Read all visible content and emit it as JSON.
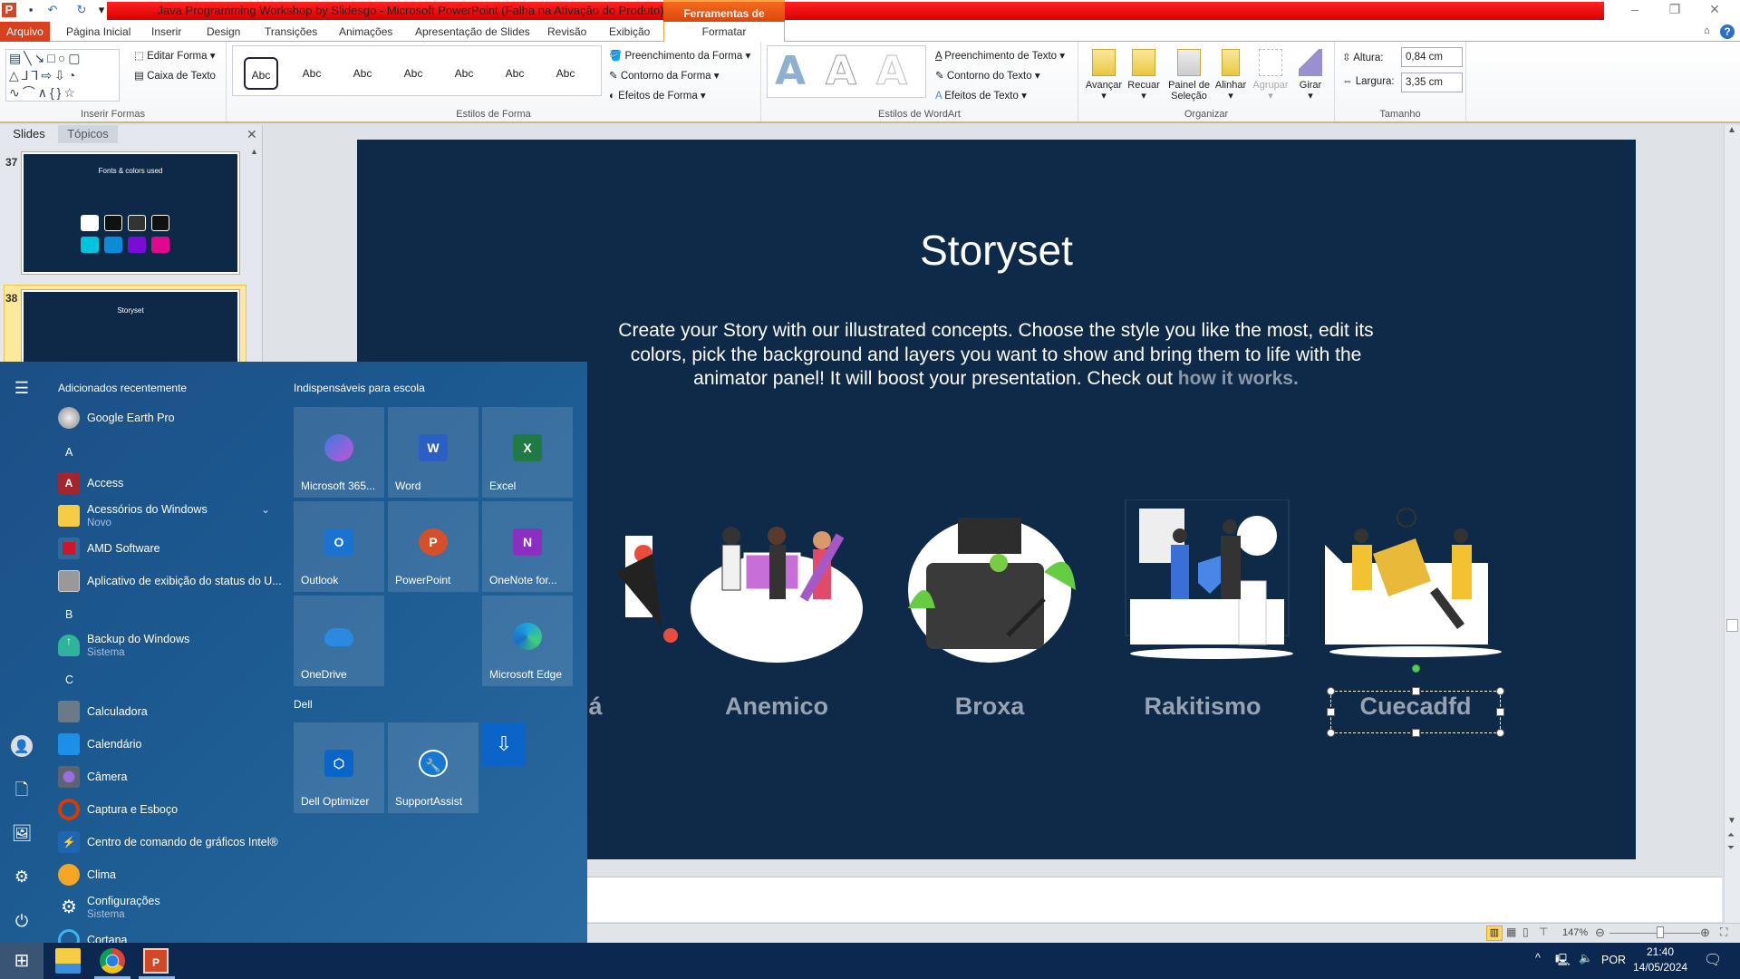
{
  "window": {
    "title": "Java Programming Workshop by Slidesgo  -  Microsoft PowerPoint (Falha na Ativação do Produto)",
    "context_tab_group": "Ferramentas de Desenho"
  },
  "tabs": [
    "Arquivo",
    "Página Inicial",
    "Inserir",
    "Design",
    "Transições",
    "Animações",
    "Apresentação de Slides",
    "Revisão",
    "Exibição",
    "Formatar"
  ],
  "ribbon": {
    "insert_shapes": {
      "edit_shape": "Editar Forma",
      "text_box": "Caixa de Texto",
      "label": "Inserir Formas"
    },
    "shape_styles": {
      "samples": [
        "Abc",
        "Abc",
        "Abc",
        "Abc",
        "Abc",
        "Abc",
        "Abc"
      ],
      "fill": "Preenchimento da Forma",
      "outline": "Contorno da Forma",
      "effects": "Efeitos de Forma",
      "label": "Estilos de Forma"
    },
    "wordart": {
      "letters": [
        "A",
        "A",
        "A"
      ],
      "fill": "Preenchimento de Texto",
      "outline": "Contorno do Texto",
      "effects": "Efeitos de Texto",
      "label": "Estilos de WordArt"
    },
    "arrange": {
      "buttons": [
        "Avançar",
        "Recuar",
        "Painel de Seleção",
        "Alinhar",
        "Agrupar",
        "Girar"
      ],
      "label": "Organizar"
    },
    "size": {
      "height_label": "Altura:",
      "height_value": "0,84 cm",
      "width_label": "Largura:",
      "width_value": "3,35 cm",
      "label": "Tamanho"
    }
  },
  "slides_pane": {
    "tabs": [
      "Slides",
      "Tópicos"
    ],
    "thumbs": [
      {
        "number": "37",
        "title": "Fonts & colors used"
      },
      {
        "number": "38",
        "title": "Storyset"
      }
    ]
  },
  "slide": {
    "title": "Storyset",
    "body": "Create your Story with our illustrated concepts. Choose the style you like the most, edit its colors, pick the background and layers you want to show and bring them to life with the animator panel! It will boost your presentation. Check out ",
    "link": "how it works.",
    "labels": [
      "á",
      "Anemico",
      "Broxa",
      "Rakitismo",
      "Cuecadfd"
    ]
  },
  "status": {
    "zoom": "147%"
  },
  "start_menu": {
    "recent_header": "Adicionados recentemente",
    "apps": [
      {
        "name": "Google Earth Pro"
      },
      {
        "letter": "A"
      },
      {
        "name": "Access"
      },
      {
        "name": "Acessórios do Windows",
        "sub": "Novo"
      },
      {
        "name": "AMD Software"
      },
      {
        "name": "Aplicativo de exibição do status do U..."
      },
      {
        "letter": "B"
      },
      {
        "name": "Backup do Windows",
        "sub": "Sistema"
      },
      {
        "letter": "C"
      },
      {
        "name": "Calculadora"
      },
      {
        "name": "Calendário"
      },
      {
        "name": "Câmera"
      },
      {
        "name": "Captura e Esboço"
      },
      {
        "name": "Centro de comando de gráficos Intel®"
      },
      {
        "name": "Clima"
      },
      {
        "name": "Configurações",
        "sub": "Sistema"
      },
      {
        "name": "Cortana"
      }
    ],
    "tile_group_1": "Indispensáveis para escola",
    "tiles_1": [
      "Microsoft 365...",
      "Word",
      "Excel",
      "Outlook",
      "PowerPoint",
      "OneNote for...",
      "OneDrive",
      "Microsoft Edge"
    ],
    "tile_group_2": "Dell",
    "tiles_2": [
      "Dell Optimizer",
      "SupportAssist"
    ]
  },
  "taskbar": {
    "language": "POR",
    "time": "21:40",
    "date": "14/05/2024"
  },
  "colors": {
    "slide_bg": "#0f2a48",
    "start_bg": "#1d5a8e",
    "taskbar": "#0d2850",
    "title_red": "#e00000",
    "file_tab": "#d9411e"
  }
}
